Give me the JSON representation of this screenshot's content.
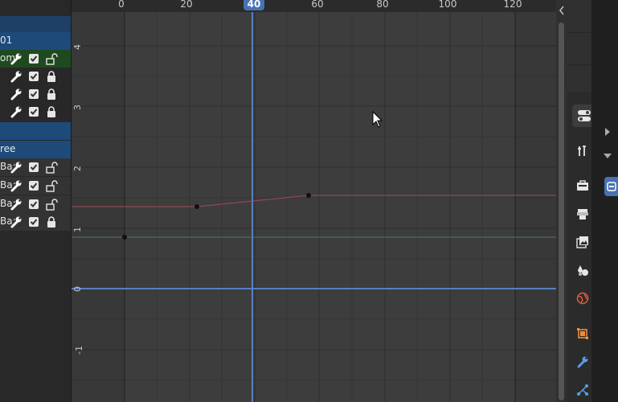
{
  "channels": [
    {
      "label": "01",
      "highlight": "selected"
    },
    {
      "label": "om",
      "highlight": "group"
    },
    {
      "label": "",
      "highlight": "none"
    },
    {
      "label": "",
      "highlight": "none"
    },
    {
      "label": "",
      "highlight": "none"
    },
    {
      "label": "",
      "highlight": "selected"
    },
    {
      "label": "ree",
      "highlight": "selected"
    },
    {
      "label": "Ba:",
      "highlight": "row"
    },
    {
      "label": "Ba:",
      "highlight": "row"
    },
    {
      "label": "Ba:",
      "highlight": "row"
    },
    {
      "label": "Ba:",
      "highlight": "row"
    }
  ],
  "ruler": {
    "ticks": [
      "0",
      "20",
      "60",
      "80",
      "100",
      "120"
    ],
    "current_frame": "40"
  },
  "yaxis": {
    "labels": [
      "4",
      "3",
      "2",
      "1",
      "0",
      "-1"
    ]
  },
  "colors": {
    "accent": "#4772b3",
    "selected_channel": "#1e4a7a",
    "group_channel": "#1f4a1f",
    "red_curve": "#a04a55",
    "green_curve": "#4a7a52",
    "blue_axis": "#5680c2"
  },
  "right_icons": [
    "tool-icon",
    "render-icon",
    "output-icon",
    "view-layer-icon",
    "scene-icon",
    "world-icon",
    "object-icon",
    "modifier-icon",
    "particles-icon"
  ]
}
